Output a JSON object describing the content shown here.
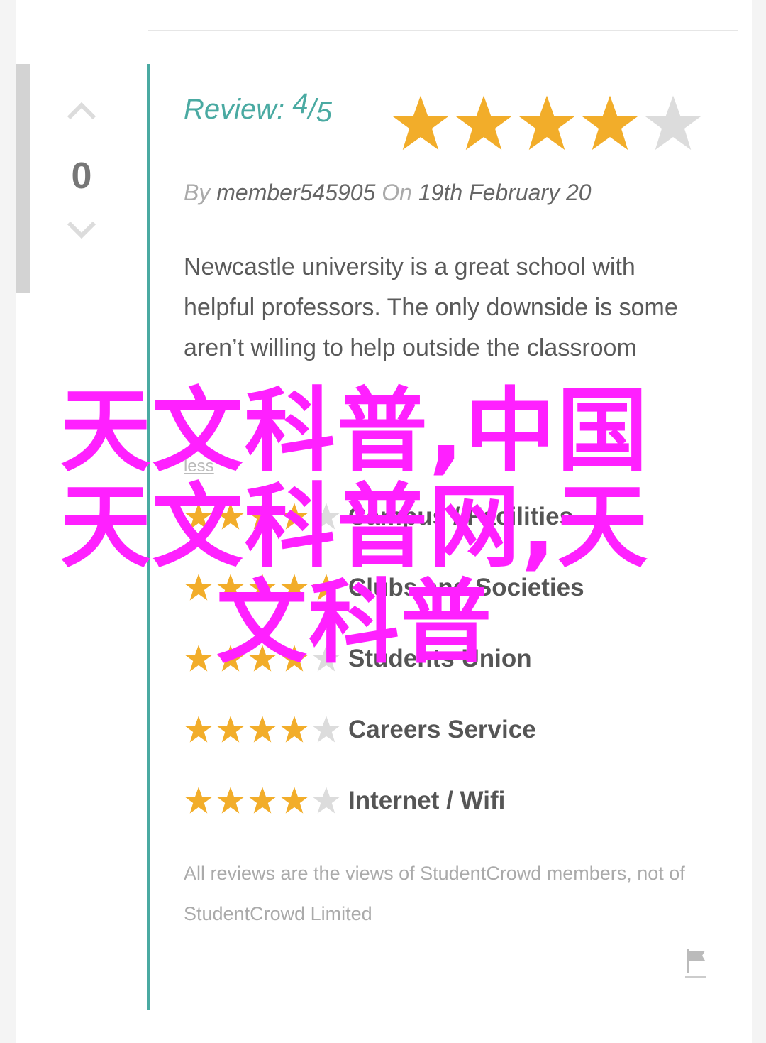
{
  "vote": {
    "up_icon": "chevron-up-icon",
    "down_icon": "chevron-down-icon",
    "count": "0"
  },
  "review": {
    "heading_label": "Review:",
    "score": "4",
    "slash": "/",
    "out_of": "5",
    "rating": 4,
    "max_rating": 5,
    "by_label": "By",
    "author": "member545905",
    "on_label": "On",
    "date": "19th February 20",
    "text": "Newcastle university is a great school with helpful professors. The only downside is some aren’t willing to help outside the classroom",
    "less_link": "less"
  },
  "category_ratings": [
    {
      "label": "Campus / Facilities",
      "rating": 4
    },
    {
      "label": "Clubs and Societies",
      "rating": 5
    },
    {
      "label": "Students Union",
      "rating": 4
    },
    {
      "label": "Careers Service",
      "rating": 4
    },
    {
      "label": "Internet / Wifi",
      "rating": 4
    }
  ],
  "disclaimer": "All reviews are the views of StudentCrowd members, not of StudentCrowd Limited",
  "flag_icon": "flag-icon",
  "overlay": {
    "line1": "天文科普,中国",
    "line2": "天文科普网,天",
    "line3": "文科普"
  },
  "colors": {
    "accent": "#4aaaa2",
    "star_filled": "#f2ad2a",
    "star_empty": "#dcdcdc",
    "overlay": "#ff20ff"
  }
}
